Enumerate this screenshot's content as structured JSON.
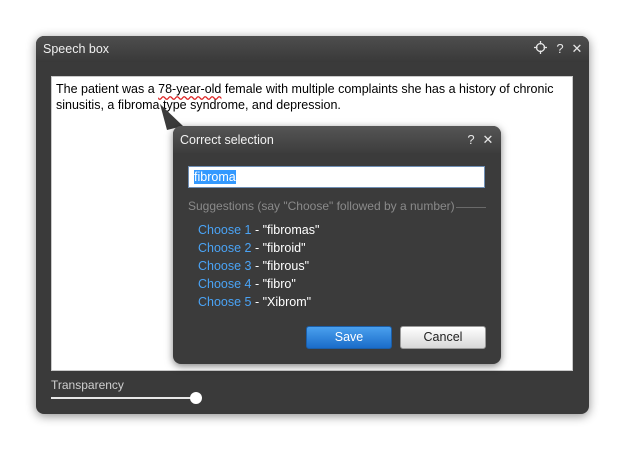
{
  "speech_box": {
    "title": "Speech box",
    "text_before": "The patient was a ",
    "text_flagged": "78-year-old",
    "text_after": " female with multiple complaints she has a history of chronic sinusitis, a fibroma type syndrome, and depression.",
    "transparency_label": "Transparency",
    "transparency_level_percent": 100
  },
  "correct_selection": {
    "title": "Correct selection",
    "selected_text": "fibroma",
    "suggestions_header": "Suggestions (say \"Choose\" followed by a number)",
    "suggestions": [
      {
        "choose": "Choose 1",
        "text": " - \"fibromas\""
      },
      {
        "choose": "Choose 2",
        "text": " - \"fibroid\""
      },
      {
        "choose": "Choose 3",
        "text": " - \"fibrous\""
      },
      {
        "choose": "Choose 4",
        "text": " - \"fibro\""
      },
      {
        "choose": "Choose 5",
        "text": " - \"Xibrom\""
      }
    ],
    "save_label": "Save",
    "cancel_label": "Cancel"
  },
  "titlebar": {
    "help_label": "?",
    "close_label": "✕"
  }
}
